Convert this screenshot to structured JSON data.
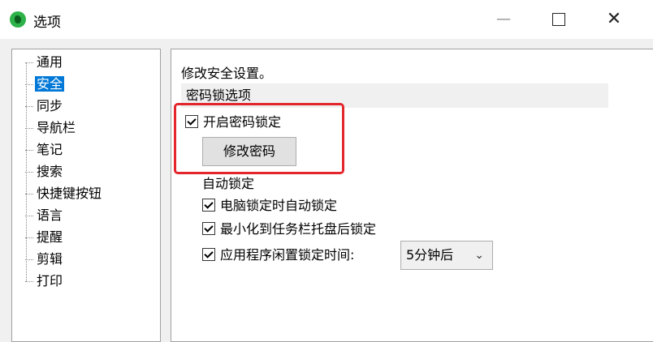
{
  "window": {
    "title": "选项",
    "minimize": "—",
    "close": "✕"
  },
  "sidebar": {
    "items": [
      {
        "label": "通用"
      },
      {
        "label": "安全",
        "selected": true
      },
      {
        "label": "同步"
      },
      {
        "label": "导航栏"
      },
      {
        "label": "笔记"
      },
      {
        "label": "搜索"
      },
      {
        "label": "快捷键按钮"
      },
      {
        "label": "语言"
      },
      {
        "label": "提醒"
      },
      {
        "label": "剪辑"
      },
      {
        "label": "打印"
      }
    ]
  },
  "security": {
    "heading": "修改安全设置。",
    "section_title": "密码锁选项",
    "enable_lock": {
      "label": "开启密码锁定",
      "checked": true
    },
    "change_password_button": "修改密码",
    "auto_lock_label": "自动锁定",
    "lock_on_computer_lock": {
      "label": "电脑锁定时自动锁定",
      "checked": true
    },
    "lock_on_minimize": {
      "label": "最小化到任务栏托盘后锁定",
      "checked": true
    },
    "lock_on_idle": {
      "label": "应用程序闲置锁定时间:",
      "checked": true
    },
    "idle_time_select": {
      "value": "5分钟后"
    }
  },
  "colors": {
    "selection": "#0078d7",
    "highlight_border": "#e3262c",
    "app_icon": "#2db24a"
  }
}
